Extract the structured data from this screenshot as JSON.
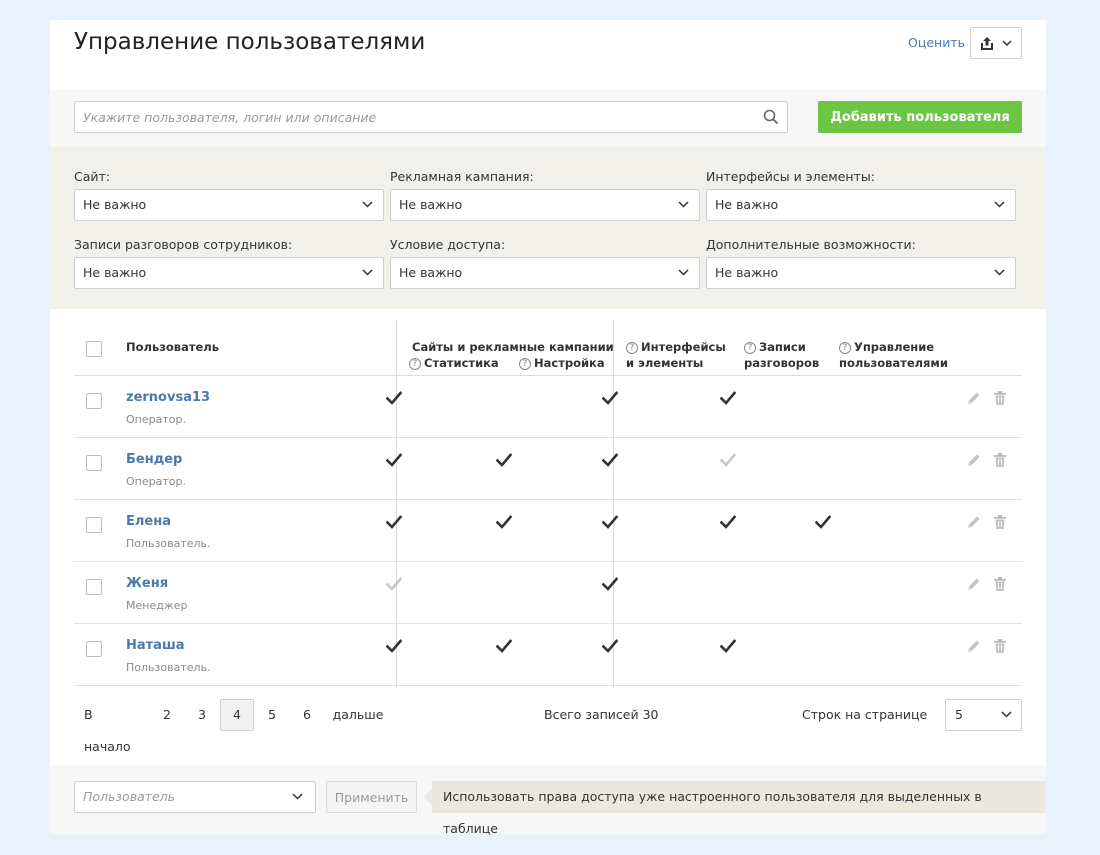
{
  "header": {
    "title": "Управление пользователями",
    "rate_link": "Оценить",
    "export_icon": "share-export-icon"
  },
  "search": {
    "placeholder": "Укажите пользователя, логин или описание",
    "add_button": "Добавить пользователя"
  },
  "filters": [
    {
      "label": "Сайт:",
      "value": "Не важно"
    },
    {
      "label": "Рекламная кампания:",
      "value": "Не важно"
    },
    {
      "label": "Интерфейсы и элементы:",
      "value": "Не важно"
    },
    {
      "label": "Записи разговоров сотрудников:",
      "value": "Не важно"
    },
    {
      "label": "Условие доступа:",
      "value": "Не важно"
    },
    {
      "label": "Дополнительные возможности:",
      "value": "Не важно"
    }
  ],
  "table": {
    "headers": {
      "user": "Пользователь",
      "sites_group": "Сайты и рекламные кампании",
      "stats": "Статистика",
      "settings": "Настройка",
      "interfaces_line1": "Интерфейсы",
      "interfaces_line2": "и элементы",
      "records_line1": "Записи",
      "records_line2": "разговоров",
      "users_mgmt_line1": "Управление",
      "users_mgmt_line2": "пользователями"
    },
    "rows": [
      {
        "name": "zernovsa13",
        "role": "Оператор.",
        "stats": "on",
        "settings": "none",
        "interfaces": "on",
        "records": "on",
        "users_mgmt": "none"
      },
      {
        "name": "Бендер",
        "role": "Оператор.",
        "stats": "on",
        "settings": "on",
        "interfaces": "on",
        "records": "partial",
        "users_mgmt": "none"
      },
      {
        "name": "Елена",
        "role": "Пользователь.",
        "stats": "on",
        "settings": "on",
        "interfaces": "on",
        "records": "on",
        "users_mgmt": "on"
      },
      {
        "name": "Женя",
        "role": "Менеджер",
        "stats": "partial",
        "settings": "none",
        "interfaces": "on",
        "records": "none",
        "users_mgmt": "none"
      },
      {
        "name": "Наташа",
        "role": "Пользователь.",
        "stats": "on",
        "settings": "on",
        "interfaces": "on",
        "records": "on",
        "users_mgmt": "none"
      }
    ]
  },
  "pagination": {
    "first": "В начало",
    "pages": [
      "2",
      "3",
      "4",
      "5",
      "6"
    ],
    "current": "4",
    "next": "дальше",
    "total": "Всего записей 30",
    "rows_label": "Строк на странице",
    "rows_value": "5"
  },
  "bulk": {
    "user_placeholder": "Пользователь",
    "apply": "Применить",
    "hint": "Использовать права доступа уже настроенного пользователя для выделенных в таблице"
  },
  "colors": {
    "accent_green": "#6cc644",
    "link_blue": "#4a7aad",
    "check_dark": "#333333",
    "check_light": "#c8c8c8",
    "filter_bg": "#f2f0ea"
  }
}
